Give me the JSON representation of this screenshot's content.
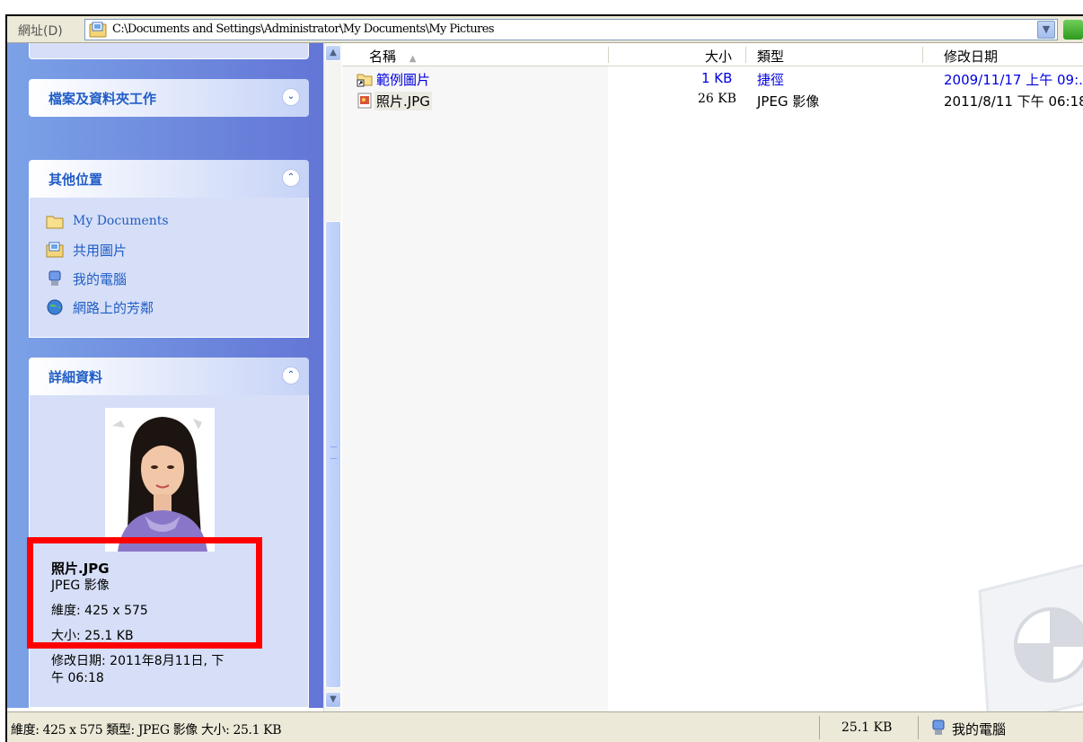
{
  "address_bar": {
    "label": "網址(D)",
    "path": "C:\\Documents and Settings\\Administrator\\My Documents\\My Pictures"
  },
  "task_pane": {
    "file_tasks": {
      "title": "檔案及資料夾工作",
      "toggle": "expand"
    },
    "other_places": {
      "title": "其他位置",
      "toggle": "collapse",
      "items": [
        {
          "label": "My Documents",
          "icon": "folder-icon"
        },
        {
          "label": "共用圖片",
          "icon": "shared-pictures-icon"
        },
        {
          "label": "我的電腦",
          "icon": "computer-icon"
        },
        {
          "label": "網路上的芳鄰",
          "icon": "network-icon"
        }
      ]
    },
    "details": {
      "title": "詳細資料",
      "toggle": "collapse",
      "file_name": "照片.JPG",
      "file_type": "JPEG 影像",
      "dimensions": "維度: 425 x 575",
      "size": "大小: 25.1 KB",
      "modified_line1": "修改日期: 2011年8月11日, 下",
      "modified_line2": "午 06:18"
    }
  },
  "file_list": {
    "columns": {
      "name": "名稱",
      "size": "大小",
      "type": "類型",
      "modified": "修改日期"
    },
    "rows": [
      {
        "name": "範例圖片",
        "size": "1 KB",
        "type": "捷徑",
        "modified": "2009/11/17 上午 09:...",
        "icon": "folder-shortcut-icon"
      },
      {
        "name": "照片.JPG",
        "size": "26 KB",
        "type": "JPEG 影像",
        "modified": "2011/8/11 下午 06:18",
        "icon": "jpeg-file-icon"
      }
    ]
  },
  "status_bar": {
    "text": "維度: 425 x 575 類型: JPEG 影像 大小: 25.1 KB",
    "size": "25.1 KB",
    "location": "我的電腦"
  },
  "colors": {
    "link_blue": "#215dc6",
    "pane_blue": "#6375d6",
    "highlight": "#ff0000"
  }
}
